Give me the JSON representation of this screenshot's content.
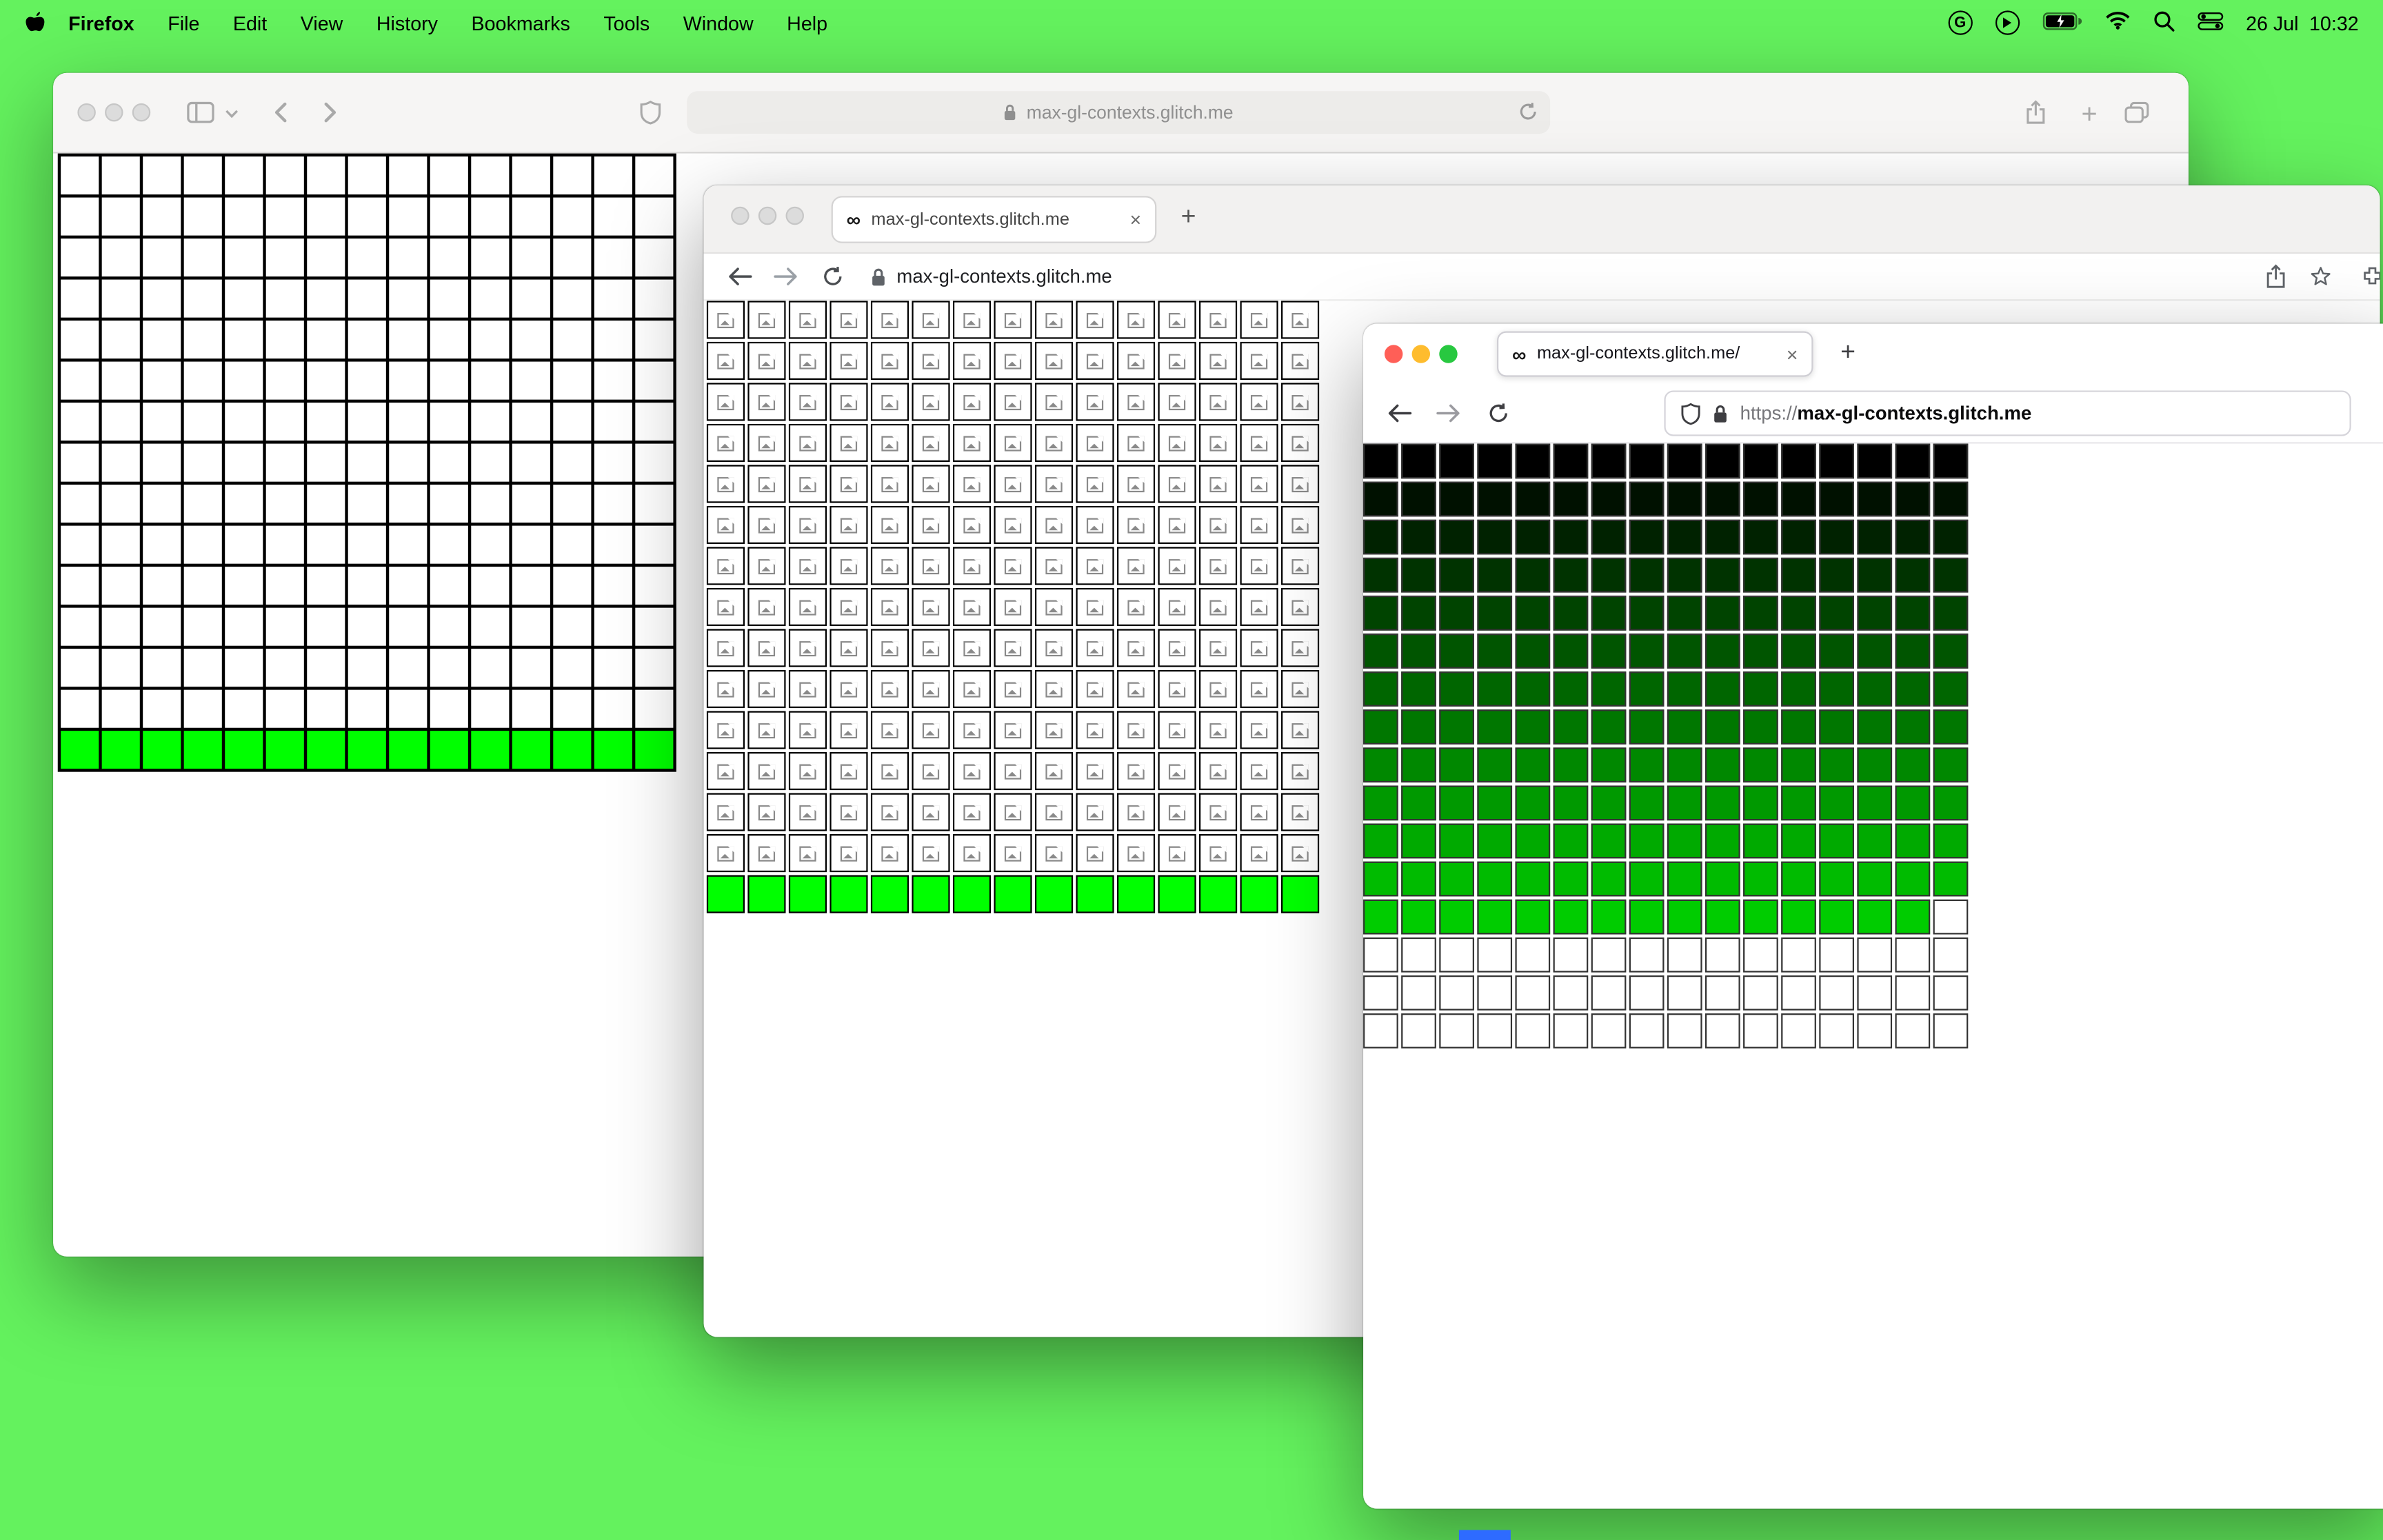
{
  "menu_bar": {
    "app_name": "Firefox",
    "items": [
      "File",
      "Edit",
      "View",
      "History",
      "Bookmarks",
      "Tools",
      "Window",
      "Help"
    ],
    "date": "26 Jul",
    "time": "10:32",
    "status_icons": [
      "grammarly-icon",
      "play-icon",
      "battery-icon",
      "wifi-icon",
      "search-icon",
      "control-center-icon"
    ]
  },
  "desktop": {
    "background": "#64f25e"
  },
  "glyphs": {
    "plus": "+",
    "close": "×",
    "infinity": "∞"
  },
  "safari_window": {
    "url": "max-gl-contexts.glitch.me"
  },
  "middle_window": {
    "tab_title": "max-gl-contexts.glitch.me",
    "url": "max-gl-contexts.glitch.me"
  },
  "firefox_window": {
    "tab_title": "max-gl-contexts.glitch.me/",
    "url_scheme": "https://",
    "url_host": "max-gl-contexts.glitch.me",
    "traffic_lights": [
      "#ff5f57",
      "#febc2e",
      "#28c840"
    ]
  },
  "grids": {
    "safari": {
      "cols": 15,
      "cell": 25,
      "gap": 2,
      "pad": 2,
      "bg": "#000000",
      "rows": [
        {
          "count": 14,
          "color": "#ffffff"
        },
        {
          "count": 1,
          "color": "#00ff00"
        }
      ]
    },
    "middle": {
      "cols": 15,
      "cell": 25,
      "gap": 2,
      "border": "#000000",
      "rows": [
        {
          "count": 14,
          "color": "#ffffff",
          "icon": true
        },
        {
          "count": 1,
          "color": "#00ff00"
        }
      ]
    },
    "firefox": {
      "cols": 16,
      "cell": 23,
      "gap": 2,
      "border": "#333333",
      "rows": [
        {
          "count": 1,
          "color": "#000000"
        },
        {
          "count": 1,
          "color": "#001100"
        },
        {
          "count": 1,
          "color": "#002200"
        },
        {
          "count": 1,
          "color": "#003300"
        },
        {
          "count": 1,
          "color": "#004400"
        },
        {
          "count": 1,
          "color": "#005500"
        },
        {
          "count": 1,
          "color": "#006600"
        },
        {
          "count": 1,
          "color": "#007700"
        },
        {
          "count": 1,
          "color": "#008800"
        },
        {
          "count": 1,
          "color": "#009900"
        },
        {
          "count": 1,
          "color": "#00aa00"
        },
        {
          "count": 1,
          "color": "#00bb00"
        },
        {
          "count": 1,
          "color": "#00cc00"
        },
        {
          "count": 3,
          "color": "#ffffff"
        }
      ],
      "overrides": [
        {
          "row": 12,
          "col": 15,
          "color": "#ffffff"
        }
      ]
    }
  }
}
